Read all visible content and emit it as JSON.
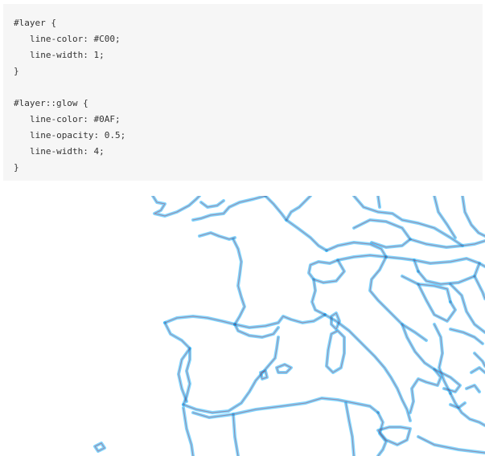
{
  "code": {
    "lines": [
      "#layer {",
      "line-color: #C00;",
      "line-width: 1;",
      "}",
      "",
      "#layer::glow {",
      "line-color: #0AF;",
      "line-opacity: 0.5;",
      "line-width: 4;",
      "}"
    ]
  },
  "map": {
    "line_color": "#C00",
    "line_width": 1,
    "glow_color": "#0AF",
    "glow_opacity": 0.5,
    "glow_width": 4
  }
}
